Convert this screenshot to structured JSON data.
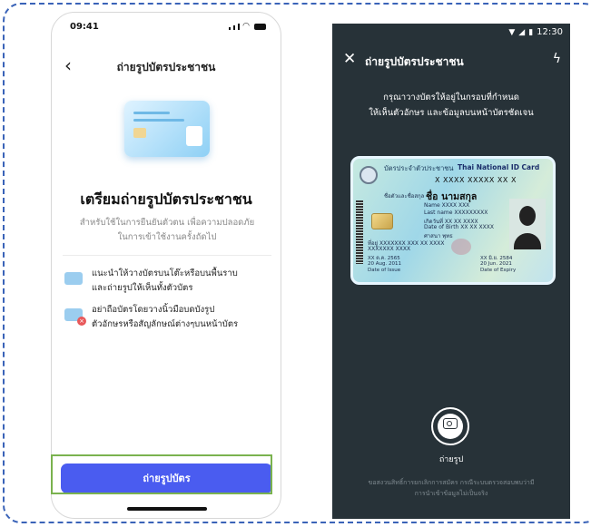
{
  "left_screen": {
    "status_time": "09:41",
    "back_icon": "chevron-left-icon",
    "nav_title": "ถ่ายรูปบัตรประชาชน",
    "illustration_icon": "id-card-illustration",
    "prep_title": "เตรียมถ่ายรูปบัตรประชาชน",
    "prep_subtitle_line1": "สำหรับใช้ในการยืนยันตัวตน เพื่อความปลอดภัย",
    "prep_subtitle_line2": "ในการเข้าใช้งานครั้งถัดไป",
    "tips": [
      {
        "icon": "card-flat-icon",
        "line1": "แนะนำให้วางบัตรบนโต๊ะหรือบนพื้นราบ",
        "line2": "และถ่ายรูปให้เห็นทั้งตัวบัตร"
      },
      {
        "icon": "card-blocked-icon",
        "line1": "อย่าถือบัตรโดยวางนิ้วมือบดบังรูป",
        "line2": "ตัวอักษรหรือสัญลักษณ์ต่างๆบนหน้าบัตร"
      }
    ],
    "primary_button_label": "ถ่ายรูปบัตร",
    "accent_color": "#4a5cf0",
    "highlight_color": "#7ab24f"
  },
  "right_screen": {
    "status_time": "12:30",
    "close_icon": "close-icon",
    "title": "ถ่ายรูปบัตรประชาชน",
    "flash_icon": "flash-icon",
    "instruction_line1": "กรุณาวางบัตรให้อยู่ในกรอบที่กำหนด",
    "instruction_line2": "ให้เห็นตัวอักษร และข้อมูลบนหน้าบัตรชัดเจน",
    "id_card": {
      "title_th": "บัตรประจำตัวประชาชน",
      "title_en": "Thai National ID Card",
      "id_number": "X XXXX XXXXX XX X",
      "name_label": "ชื่อตัวและชื่อสกุล",
      "name_value": "ชื่อ นามสกุล",
      "name_en": "Name XXXX XXX",
      "lastname_en": "Last name XXXXXXXXX",
      "dob_th": "เกิดวันที่ XX XX XXXX",
      "dob_en": "Date of Birth XX XX XXXX",
      "religion": "ศาสนา พุทธ",
      "address": "ที่อยู่ XXXXXXX XXX XX XXXX",
      "address2": "XXXXXXX XXXX",
      "issue_th": "XX ต.ค. 2565",
      "issue_en": "20 Aug. 2011",
      "issue_label": "Date of Issue",
      "expiry_th": "XX มิ.ย. 2584",
      "expiry_en": "20 Jun. 2021",
      "expiry_label": "Date of Expiry"
    },
    "shutter_icon": "camera-icon",
    "shutter_label": "ถ่ายรูป",
    "disclaimer_line1": "ขอสงวนสิทธิ์การยกเลิกการสมัคร กรณีระบบตรวจสอบพบว่ามี",
    "disclaimer_line2": "การนำเข้าข้อมูลไม่เป็นจริง",
    "background_color": "#273238"
  }
}
